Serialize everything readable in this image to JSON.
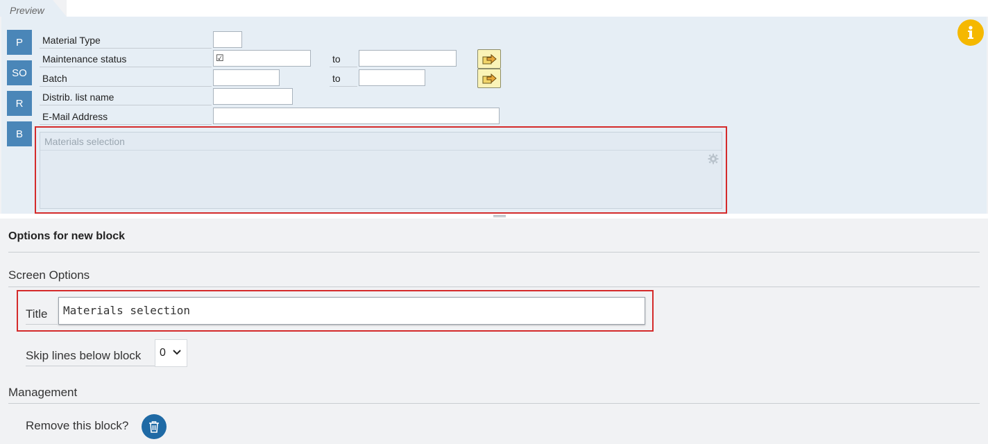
{
  "preview": {
    "tab_label": "Preview",
    "side_buttons": [
      "P",
      "SO",
      "R",
      "B"
    ],
    "fields": {
      "material_type": "Material Type",
      "maintenance_status": "Maintenance status",
      "maintenance_status_value": "☑",
      "batch": "Batch",
      "distrib_list_name": "Distrib. list name",
      "email_address": "E-Mail Address",
      "to_label": "to"
    },
    "block_title": "Materials selection",
    "icons": [
      "info-icon",
      "multiple-selection-arrow-icon",
      "gear-icon"
    ]
  },
  "options": {
    "heading": "Options for new block",
    "screen_options": {
      "title": "Screen Options",
      "title_label": "Title",
      "title_value": "Materials selection",
      "skip_label": "Skip lines below block",
      "skip_value": "0"
    },
    "management": {
      "title": "Management",
      "remove_label": "Remove this block?"
    }
  },
  "colors": {
    "highlight": "#d42a2a",
    "side_button": "#4a86b8",
    "info": "#f5b800",
    "trash": "#1f6aa5"
  }
}
